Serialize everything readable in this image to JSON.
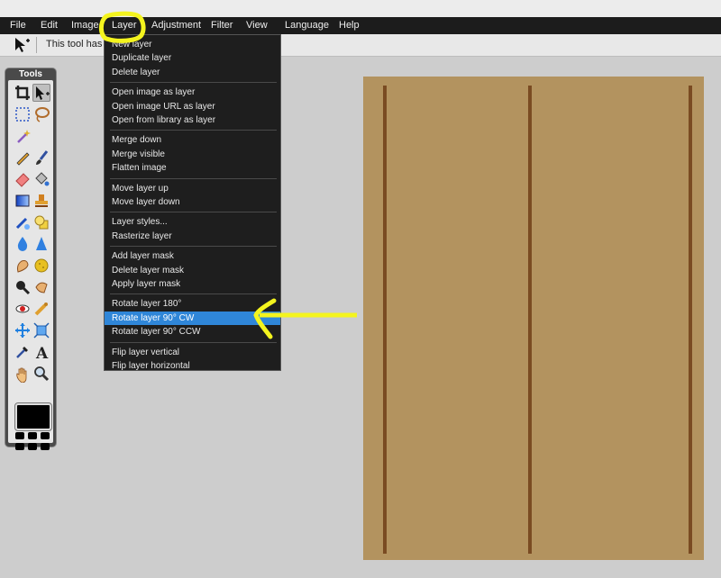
{
  "menubar": {
    "items": [
      {
        "label": "File"
      },
      {
        "label": "Edit"
      },
      {
        "label": "Image"
      },
      {
        "label": "Layer"
      },
      {
        "label": "Adjustment"
      },
      {
        "label": "Filter"
      },
      {
        "label": "View"
      },
      {
        "label": "Language"
      },
      {
        "label": "Help"
      }
    ]
  },
  "options_bar": {
    "hint": "This tool has no special options"
  },
  "tools_panel": {
    "title": "Tools",
    "tools": [
      "crop-icon",
      "move-icon",
      "marquee-icon",
      "lasso-icon",
      "magic-wand-icon",
      "pencil-icon",
      "brush-icon",
      "eraser-icon",
      "paint-bucket-icon",
      "gradient-icon",
      "stamp-icon",
      "color-replace-icon",
      "shape-icon",
      "blur-icon",
      "sharpen-icon",
      "smudge-icon",
      "sponge-icon",
      "burn-icon",
      "dodge-icon",
      "red-eye-icon",
      "bloat-icon",
      "pinch-icon",
      "spherize-icon",
      "color-picker-icon",
      "type-icon",
      "hand-icon",
      "zoom-icon"
    ],
    "foreground_color": "#000000"
  },
  "layer_menu": {
    "groups": [
      [
        "New layer",
        "Duplicate layer",
        "Delete layer"
      ],
      [
        "Open image as layer",
        "Open image URL as layer",
        "Open from library as layer"
      ],
      [
        "Merge down",
        "Merge visible",
        "Flatten image"
      ],
      [
        "Move layer up",
        "Move layer down"
      ],
      [
        "Layer styles...",
        "Rasterize layer"
      ],
      [
        "Add layer mask",
        "Delete layer mask",
        "Apply layer mask"
      ],
      [
        "Rotate layer 180°",
        "Rotate layer 90° CW",
        "Rotate layer 90° CCW"
      ],
      [
        "Flip layer vertical",
        "Flip layer horizontal"
      ]
    ],
    "highlighted": "Rotate layer 90° CW",
    "highlight_color": "#2f86d8"
  },
  "annotations": {
    "color": "#f4f41e"
  },
  "canvas": {
    "fill_color": "#b3935f",
    "stripe_color": "#7a4b22"
  }
}
